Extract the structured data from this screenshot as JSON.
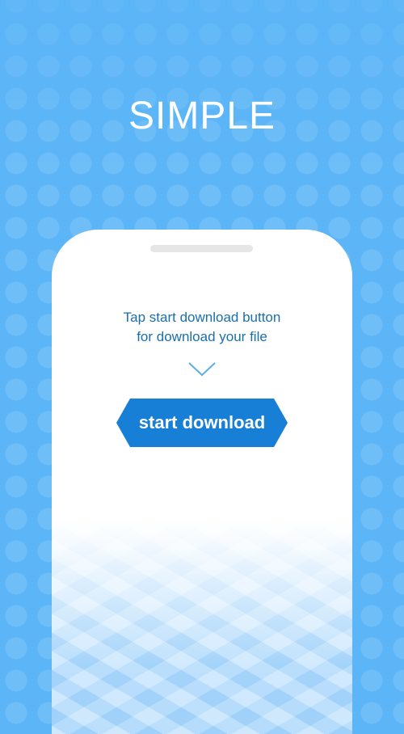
{
  "hero": {
    "title": "SIMPLE"
  },
  "phone": {
    "instruction_line1": "Tap start download button",
    "instruction_line2": "for download your file",
    "start_button_label": "start download"
  },
  "icons": {
    "arrow": "chevron-down-icon"
  },
  "colors": {
    "background": "#5bb5f7",
    "button": "#1780d6",
    "instruction_text": "#1b6fa8",
    "chevron": "#5aaee8"
  }
}
